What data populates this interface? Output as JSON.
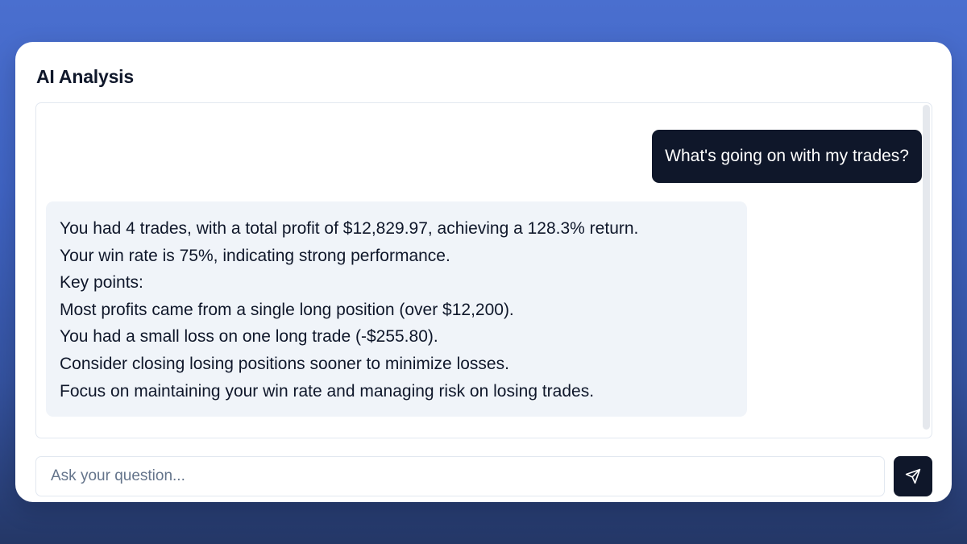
{
  "card": {
    "title": "AI Analysis"
  },
  "chat": {
    "messages": [
      {
        "role": "user",
        "text": "What's going on with my trades?"
      },
      {
        "role": "assistant",
        "lines": [
          "You had 4 trades, with a total profit of $12,829.97, achieving a 128.3% return.",
          "Your win rate is 75%, indicating strong performance.",
          "Key points:",
          "Most profits came from a single long position (over $12,200).",
          "You had a small loss on one long trade (-$255.80).",
          "Consider closing losing positions sooner to minimize losses.",
          "Focus on maintaining your win rate and managing risk on losing trades."
        ]
      }
    ]
  },
  "composer": {
    "placeholder": "Ask your question...",
    "value": "",
    "send_icon": "send-icon"
  },
  "colors": {
    "background": "#4a6fcf",
    "card": "#ffffff",
    "user_bubble": "#0f172a",
    "assistant_bubble": "#f0f4f9",
    "send_button": "#0f172a",
    "text_primary": "#0f172a",
    "placeholder": "#64748b"
  }
}
